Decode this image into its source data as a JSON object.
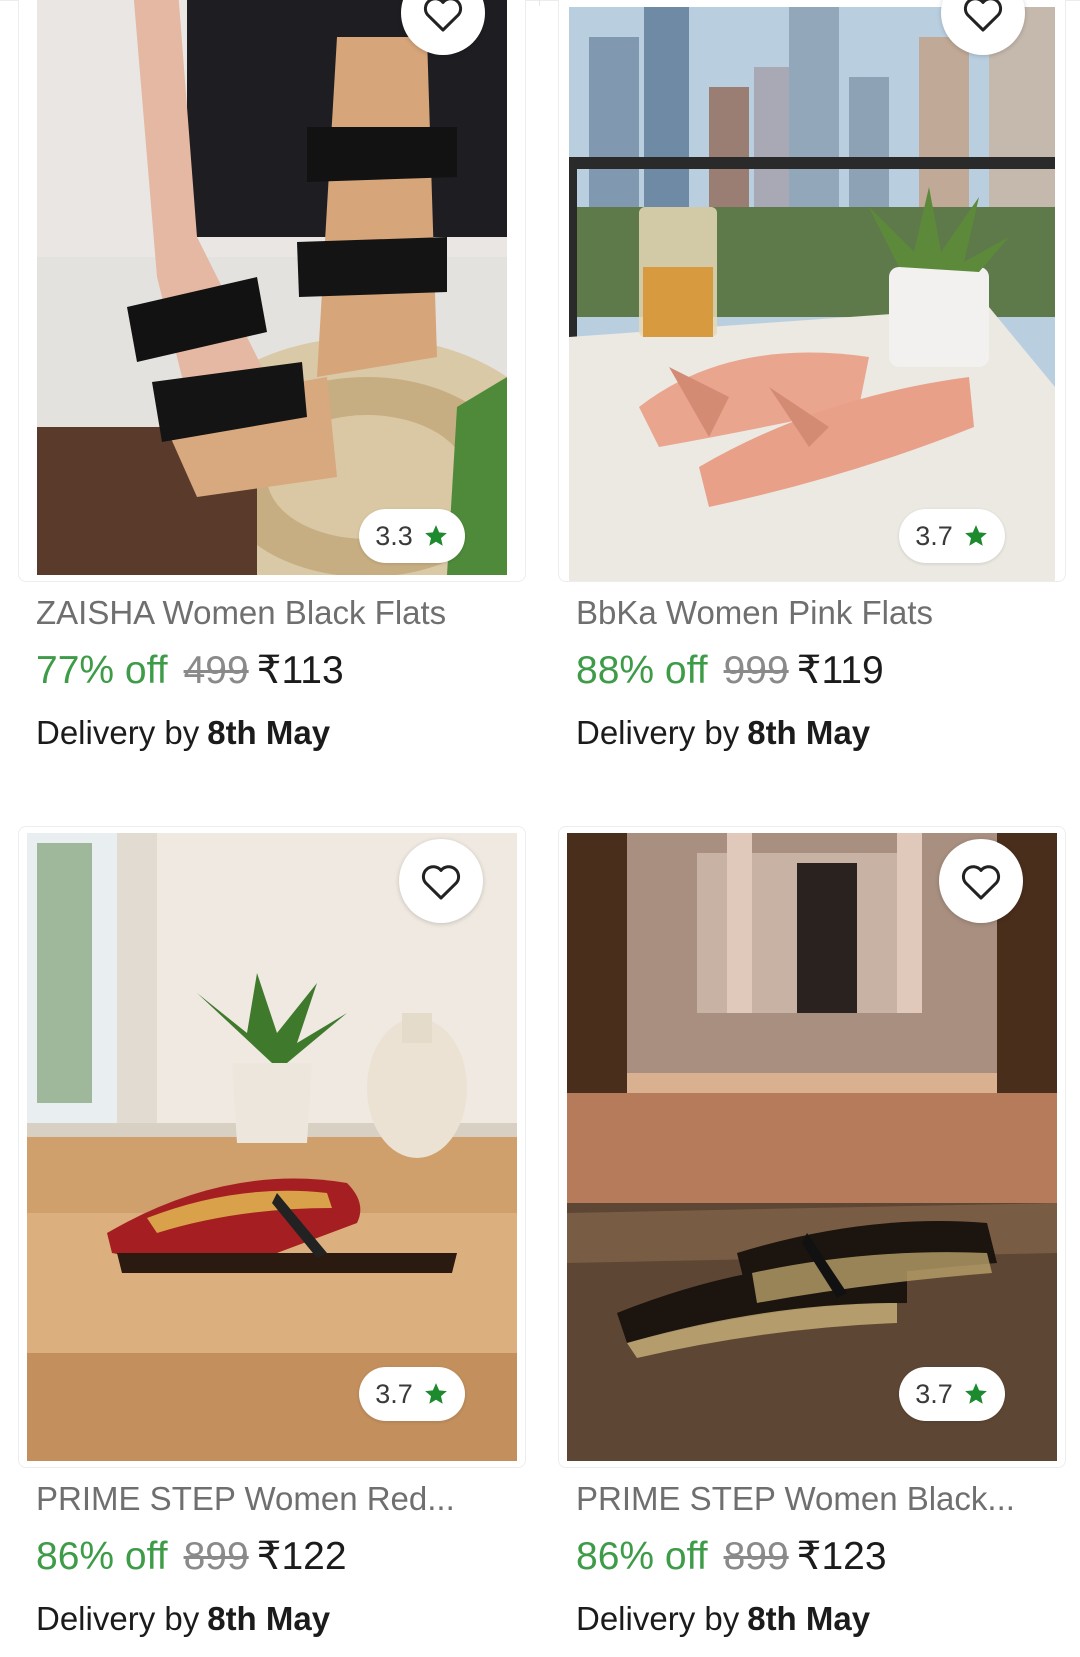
{
  "products": [
    {
      "title": "ZAISHA Women Black Flats",
      "discount": "77% off",
      "mrp": "499",
      "price": "₹113",
      "rating": "3.3",
      "delivery_label": "Delivery by",
      "delivery_date": "8th May"
    },
    {
      "title": "BbKa Women Pink Flats",
      "discount": "88% off",
      "mrp": "999",
      "price": "₹119",
      "rating": "3.7",
      "delivery_label": "Delivery by",
      "delivery_date": "8th May"
    },
    {
      "title": "PRIME STEP Women Red...",
      "discount": "86% off",
      "mrp": "899",
      "price": "₹122",
      "rating": "3.7",
      "delivery_label": "Delivery by",
      "delivery_date": "8th May"
    },
    {
      "title": "PRIME STEP Women Black...",
      "discount": "86% off",
      "mrp": "899",
      "price": "₹123",
      "rating": "3.7",
      "delivery_label": "Delivery by",
      "delivery_date": "8th May"
    }
  ],
  "icons": {
    "wishlist": "heart-outline-icon",
    "rating": "star-icon"
  },
  "colors": {
    "discount": "#3e9b48",
    "star": "#1d8a2e"
  }
}
